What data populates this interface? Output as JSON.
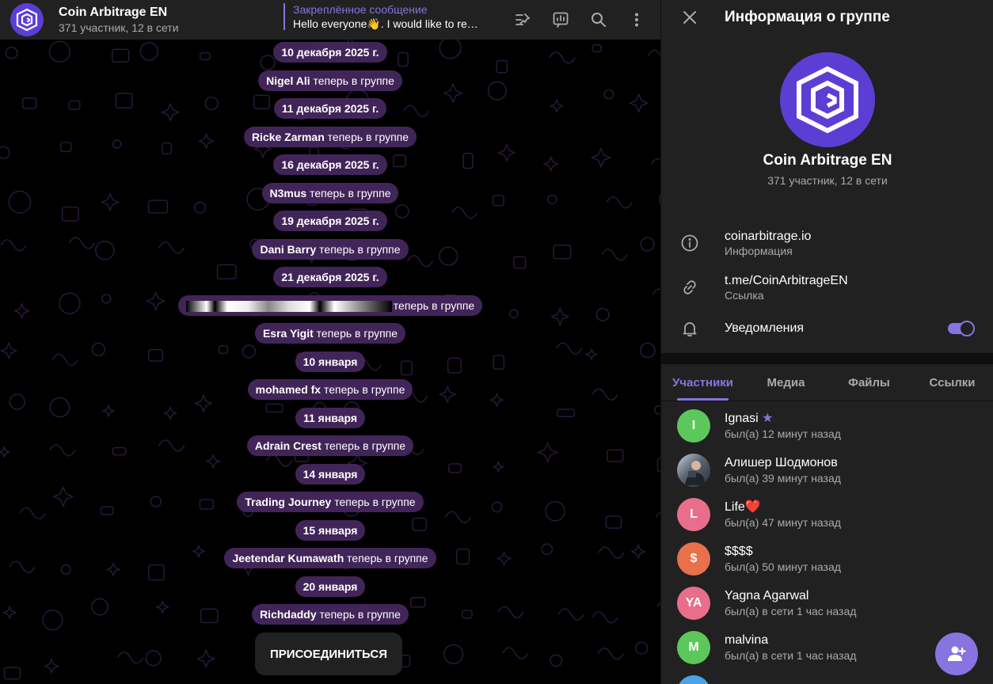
{
  "colors": {
    "accent": "#8774e1",
    "brand": "#5b3ed4",
    "pill": "#46285f",
    "panel": "#212121"
  },
  "header": {
    "title": "Coin Arbitrage EN",
    "subtitle": "371 участник, 12 в сети",
    "pinned_title": "Закреплённое сообщение",
    "pinned_text": "Hello everyone👋. I would like to rem..."
  },
  "messages": [
    {
      "type": "date",
      "text": "10 декабря 2025 г."
    },
    {
      "type": "join",
      "name": "Nigel Ali",
      "suffix": " теперь в группе"
    },
    {
      "type": "date",
      "text": "11 декабря 2025 г."
    },
    {
      "type": "join",
      "name": "Ricke Zarman",
      "suffix": " теперь в группе"
    },
    {
      "type": "date",
      "text": "16 декабря 2025 г."
    },
    {
      "type": "join",
      "name": "N3mus",
      "suffix": " теперь в группе"
    },
    {
      "type": "date",
      "text": "19 декабря 2025 г."
    },
    {
      "type": "join",
      "name": "Dani Barry",
      "suffix": " теперь в группе"
    },
    {
      "type": "date",
      "text": "21 декабря 2025 г."
    },
    {
      "type": "join_redacted",
      "suffix": "теперь в группе"
    },
    {
      "type": "join",
      "name": "Esra Yigit",
      "suffix": " теперь в группе"
    },
    {
      "type": "date",
      "text": "10 января"
    },
    {
      "type": "join",
      "name": "mohamed fx",
      "suffix": " теперь в группе"
    },
    {
      "type": "date",
      "text": "11 января"
    },
    {
      "type": "join",
      "name": "Adrain Crest",
      "suffix": " теперь в группе"
    },
    {
      "type": "date",
      "text": "14 января"
    },
    {
      "type": "join",
      "name": "Trading Journey",
      "suffix": " теперь в группе"
    },
    {
      "type": "date",
      "text": "15 января"
    },
    {
      "type": "join",
      "name": "Jeetendar Kumawath",
      "suffix": " теперь в группе"
    },
    {
      "type": "date",
      "text": "20 января"
    },
    {
      "type": "join",
      "name": "Richdaddy",
      "suffix": " теперь в группе"
    }
  ],
  "join_button": "ПРИСОЕДИНИТЬСЯ",
  "panel": {
    "title": "Информация о группе",
    "group_name": "Coin Arbitrage EN",
    "group_sub": "371 участник, 12 в сети",
    "website": "coinarbitrage.io",
    "website_label": "Информация",
    "link": "t.me/CoinArbitrageEN",
    "link_label": "Ссылка",
    "notifications": "Уведомления",
    "notifications_on": true
  },
  "tabs": [
    "Участники",
    "Медиа",
    "Файлы",
    "Ссылки"
  ],
  "members": [
    {
      "initials": "I",
      "name": "Ignasi",
      "badge": "★",
      "status": "был(а) 12 минут назад",
      "color": "#5cc85c"
    },
    {
      "initials": "",
      "name": "Алишер Шодмонов",
      "badge": "",
      "status": "был(а) 39 минут назад",
      "color": "#6b7785",
      "photo": true
    },
    {
      "initials": "L",
      "name": "Life❤️",
      "badge": "",
      "status": "был(а) 47 минут назад",
      "color": "#e86e8c"
    },
    {
      "initials": "$",
      "name": "$$$$",
      "badge": "",
      "status": "был(а) 50 минут назад",
      "color": "#e8704a"
    },
    {
      "initials": "YA",
      "name": "Yagna Agarwal",
      "badge": "",
      "status": "был(а) в сети 1 час назад",
      "color": "#e86e8c"
    },
    {
      "initials": "M",
      "name": "malvina",
      "badge": "",
      "status": "был(а) в сети 1 час назад",
      "color": "#5cc85c"
    }
  ]
}
